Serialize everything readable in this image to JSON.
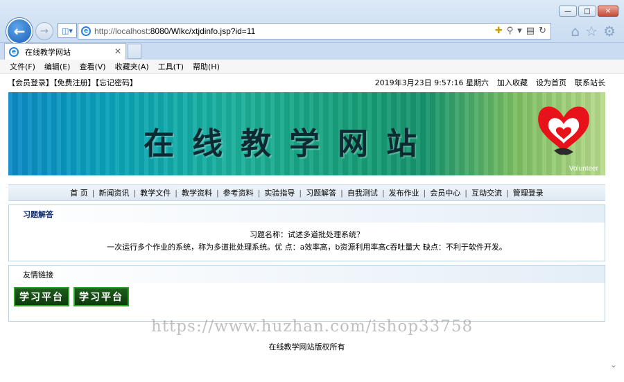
{
  "browser": {
    "url_host": "http://localhost",
    "url_path": ":8080/Wlkc/xtjdinfo.jsp?id=11",
    "tab_title": "在线教学网站",
    "menu": [
      "文件(F)",
      "编辑(E)",
      "查看(V)",
      "收藏夹(A)",
      "工具(T)",
      "帮助(H)"
    ]
  },
  "topbar": {
    "left": "【会员登录】【免费注册】【忘记密码】",
    "datetime": "2019年3月23日  9:57:16   星期六",
    "add_fav": "加入收藏",
    "set_home": "设为首页",
    "contact": "联系站长"
  },
  "banner": {
    "title": "在线教学网站",
    "logo_text": "Volunteer"
  },
  "nav": [
    "首 页",
    "新闻资讯",
    "教学文件",
    "教学资料",
    "参考资料",
    "实验指导",
    "习题解答",
    "自我测试",
    "发布作业",
    "会员中心",
    "互动交流",
    "管理登录"
  ],
  "qa_panel": {
    "heading": "习题解答",
    "question": "习题名称：试述多道批处理系统？",
    "answer": "一次运行多个作业的系统，称为多道批处理系统。优 点：a效率高，b资源利用率高c吞吐量大 缺点：不利于软件开发。"
  },
  "links_panel": {
    "heading": "友情链接",
    "items": [
      "学习平台",
      "学习平台"
    ]
  },
  "watermark": "https://www.huzhan.com/ishop33758",
  "footer": "在线教学网站版权所有",
  "colors": {
    "accent": "#0f2b6b",
    "banner_start": "#0c8bc8",
    "banner_end": "#b9dc8d"
  }
}
